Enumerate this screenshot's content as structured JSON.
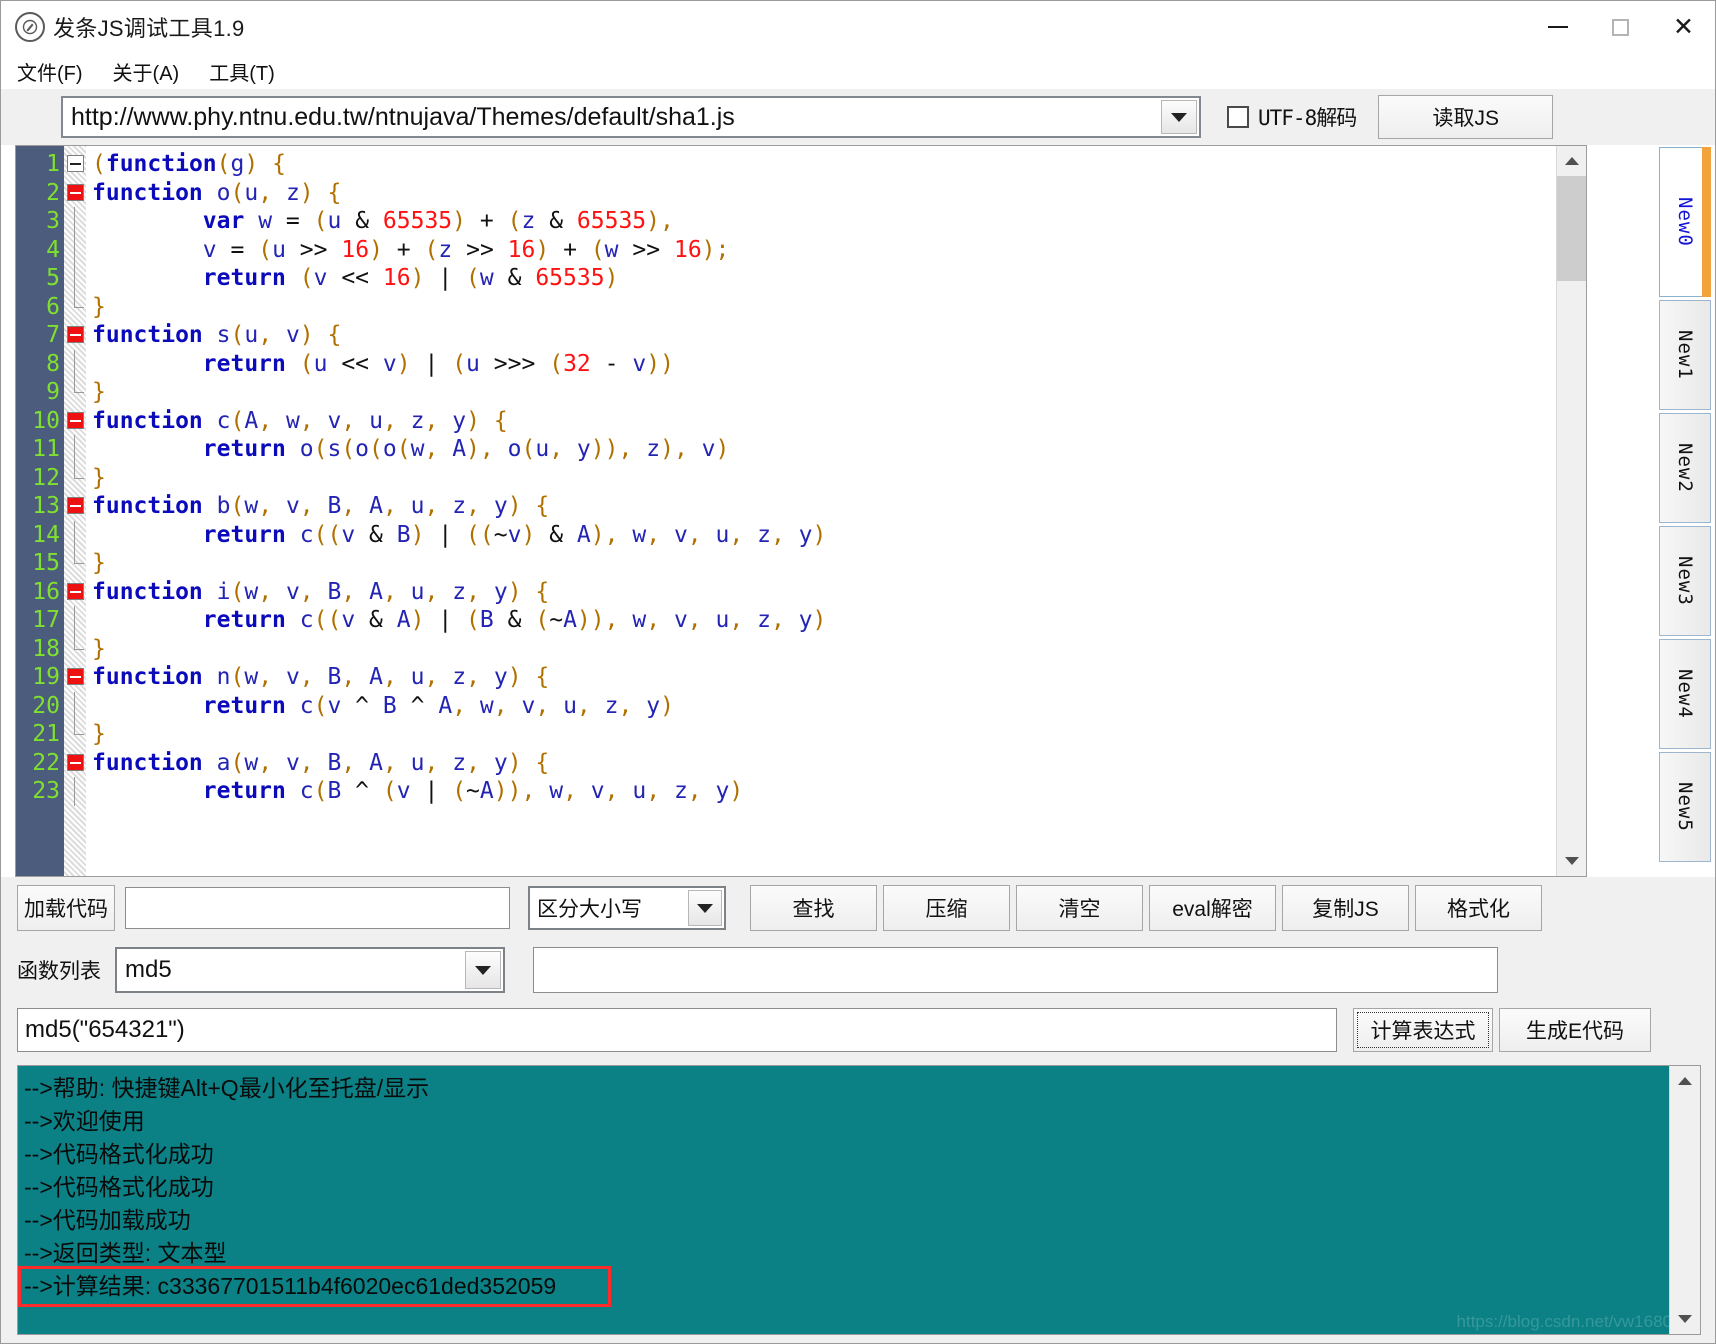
{
  "window": {
    "title": "发条JS调试工具1.9",
    "icon": "app-logo-icon",
    "minimize": "—",
    "maximize": "□",
    "close": "✕"
  },
  "menu": {
    "items": [
      {
        "label": "文件(F)"
      },
      {
        "label": "关于(A)"
      },
      {
        "label": "工具(T)"
      }
    ]
  },
  "url_bar": {
    "url": "http://www.phy.ntnu.edu.tw/ntnujava/Themes/default/sha1.js",
    "placeholder": "",
    "utf8_label": "UTF-8解码",
    "utf8_checked": false,
    "read_button": "读取JS"
  },
  "editor": {
    "active_tab": "New0",
    "tabs": [
      {
        "label": "New0",
        "active": true
      },
      {
        "label": "New1",
        "active": false
      },
      {
        "label": "New2",
        "active": false
      },
      {
        "label": "New3",
        "active": false
      },
      {
        "label": "New4",
        "active": false
      },
      {
        "label": "New5",
        "active": false
      }
    ],
    "lines": [
      {
        "n": 1,
        "fold": "open-white",
        "text": "(function(g) {"
      },
      {
        "n": 2,
        "fold": "open-red",
        "text": "function o(u, z) {"
      },
      {
        "n": 3,
        "fold": "none",
        "text": "        var w = (u & 65535) + (z & 65535),"
      },
      {
        "n": 4,
        "fold": "none",
        "text": "        v = (u >> 16) + (z >> 16) + (w >> 16);"
      },
      {
        "n": 5,
        "fold": "none",
        "text": "        return (v << 16) | (w & 65535)"
      },
      {
        "n": 6,
        "fold": "end",
        "text": "}"
      },
      {
        "n": 7,
        "fold": "open-red",
        "text": "function s(u, v) {"
      },
      {
        "n": 8,
        "fold": "none",
        "text": "        return (u << v) | (u >>> (32 - v))"
      },
      {
        "n": 9,
        "fold": "end",
        "text": "}"
      },
      {
        "n": 10,
        "fold": "open-red",
        "text": "function c(A, w, v, u, z, y) {"
      },
      {
        "n": 11,
        "fold": "none",
        "text": "        return o(s(o(o(w, A), o(u, y)), z), v)"
      },
      {
        "n": 12,
        "fold": "end",
        "text": "}"
      },
      {
        "n": 13,
        "fold": "open-red",
        "text": "function b(w, v, B, A, u, z, y) {"
      },
      {
        "n": 14,
        "fold": "none",
        "text": "        return c((v & B) | ((~v) & A), w, v, u, z, y)"
      },
      {
        "n": 15,
        "fold": "end",
        "text": "}"
      },
      {
        "n": 16,
        "fold": "open-red",
        "text": "function i(w, v, B, A, u, z, y) {"
      },
      {
        "n": 17,
        "fold": "none",
        "text": "        return c((v & A) | (B & (~A)), w, v, u, z, y)"
      },
      {
        "n": 18,
        "fold": "end",
        "text": "}"
      },
      {
        "n": 19,
        "fold": "open-red",
        "text": "function n(w, v, B, A, u, z, y) {"
      },
      {
        "n": 20,
        "fold": "none",
        "text": "        return c(v ^ B ^ A, w, v, u, z, y)"
      },
      {
        "n": 21,
        "fold": "end",
        "text": "}"
      },
      {
        "n": 22,
        "fold": "open-red",
        "text": "function a(w, v, B, A, u, z, y) {"
      },
      {
        "n": 23,
        "fold": "none",
        "text": "        return c(B ^ (v | (~A)), w, v, u, z, y)"
      }
    ]
  },
  "toolbar": {
    "load_code_button": "加载代码",
    "search_value": "",
    "search_placeholder": "",
    "case_option": "区分大小写",
    "buttons": [
      {
        "label": "查找"
      },
      {
        "label": "压缩"
      },
      {
        "label": "清空"
      },
      {
        "label": "eval解密"
      },
      {
        "label": "复制JS"
      },
      {
        "label": "格式化"
      }
    ]
  },
  "function_row": {
    "label": "函数列表",
    "selected": "md5",
    "output_value": ""
  },
  "expression_row": {
    "value": "md5(\"654321\")",
    "placeholder": "",
    "calc_button": "计算表达式",
    "generate_button": "生成E代码"
  },
  "log": {
    "lines": [
      {
        "text": "-->帮助: 快捷键Alt+Q最小化至托盘/显示",
        "highlight": false
      },
      {
        "text": "-->欢迎使用",
        "highlight": false
      },
      {
        "text": "-->代码格式化成功",
        "highlight": false
      },
      {
        "text": "-->代码格式化成功",
        "highlight": false
      },
      {
        "text": "-->代码加载成功",
        "highlight": false
      },
      {
        "text": "-->返回类型: 文本型",
        "highlight": false
      },
      {
        "text": "-->计算结果: c33367701511b4f6020ec61ded352059",
        "highlight": true
      }
    ],
    "result_hash": "c33367701511b4f6020ec61ded352059",
    "watermark": "https://blog.csdn.net/vw1680"
  },
  "colors": {
    "log_background": "#0b8185",
    "gutter_background": "#4b5c7d",
    "gutter_text": "#7fe030",
    "highlight_border": "#ff2a2a",
    "tab_accent": "#f2a33c",
    "code_keyword": "#0b0bbb",
    "code_number": "#ff1111",
    "code_paren": "#b07000"
  }
}
